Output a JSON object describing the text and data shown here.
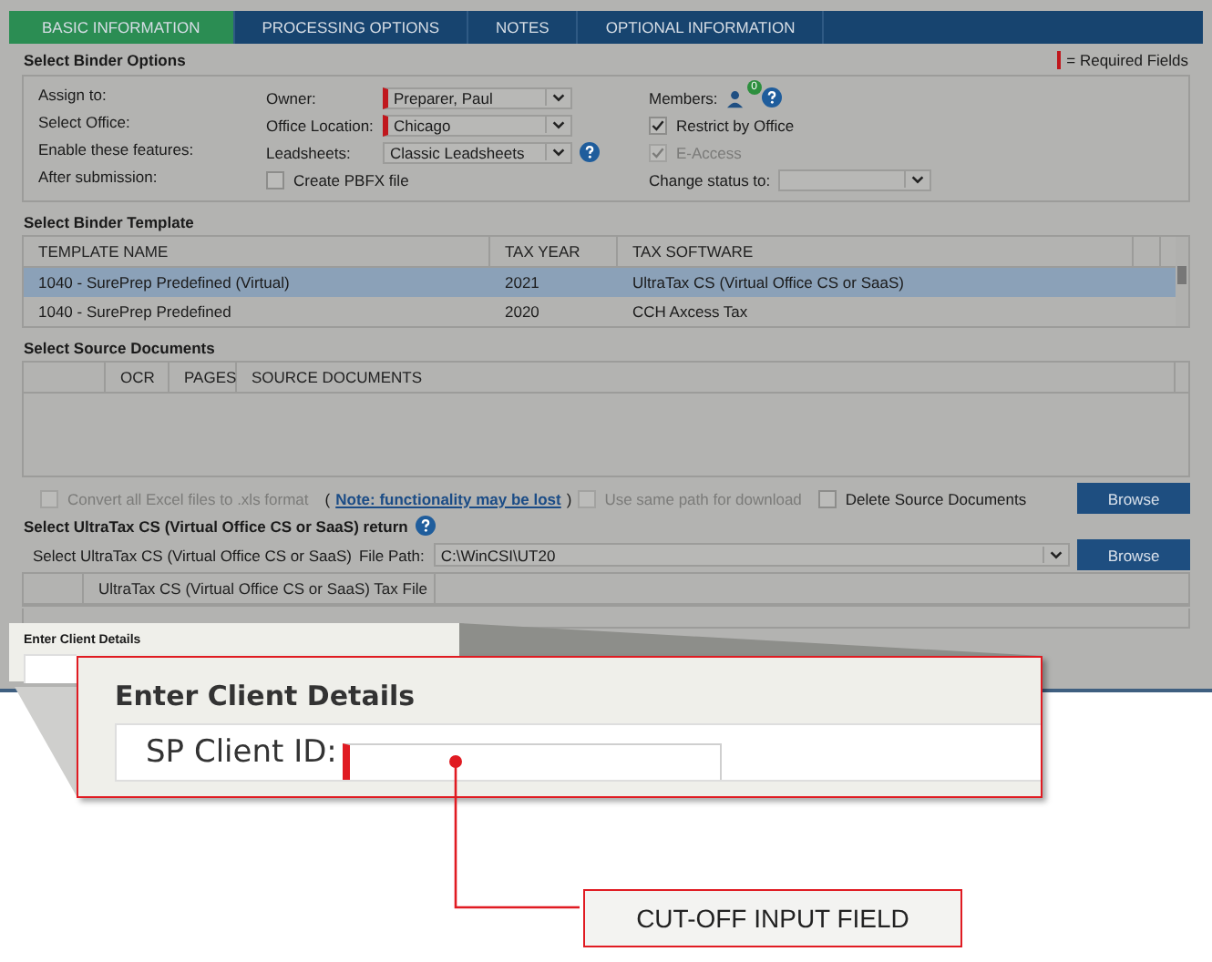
{
  "tabs": [
    {
      "label": "BASIC INFORMATION",
      "selected": true
    },
    {
      "label": "PROCESSING OPTIONS",
      "selected": false
    },
    {
      "label": "NOTES",
      "selected": false
    },
    {
      "label": "OPTIONAL INFORMATION",
      "selected": false
    }
  ],
  "binder_options": {
    "title": "Select Binder Options",
    "legend": "= Required Fields",
    "row_labels": [
      "Assign to:",
      "Select Office:",
      "Enable these features:",
      "After submission:"
    ],
    "owner": {
      "label": "Owner:",
      "value": "Preparer, Paul",
      "required": true
    },
    "office": {
      "label": "Office Location:",
      "value": "Chicago",
      "required": true
    },
    "leadsheets": {
      "label": "Leadsheets:",
      "value": "Classic Leadsheets",
      "required": false
    },
    "create_pbfx": {
      "label": "Create PBFX file",
      "checked": false,
      "disabled": false
    },
    "members": {
      "label": "Members:",
      "count": "0"
    },
    "restrict_by_office": {
      "label": "Restrict by Office",
      "checked": true,
      "disabled": false
    },
    "e_access": {
      "label": "E-Access",
      "checked": true,
      "disabled": true
    },
    "change_status": {
      "label": "Change status to:"
    }
  },
  "template": {
    "title": "Select Binder Template",
    "columns": [
      "TEMPLATE NAME",
      "TAX YEAR",
      "TAX SOFTWARE"
    ],
    "rows": [
      {
        "cells": [
          "1040 - SurePrep Predefined (Virtual)",
          "2021",
          "UltraTax CS (Virtual Office CS or SaaS)"
        ],
        "selected": true
      },
      {
        "cells": [
          "1040 - SurePrep Predefined",
          "2020",
          "CCH Axcess Tax"
        ],
        "selected": false
      }
    ]
  },
  "source_documents": {
    "title": "Select Source Documents",
    "columns": [
      "OCR",
      "PAGES",
      "SOURCE DOCUMENTS"
    ],
    "convert_excel": {
      "label": "Convert all Excel files to .xls format",
      "checked": false,
      "disabled": true
    },
    "note_open": "(",
    "note_link": "Note: functionality may be lost",
    "note_close": ")",
    "same_path": {
      "label": "Use same path for download",
      "checked": false,
      "disabled": true
    },
    "delete_source": {
      "label": "Delete Source Documents",
      "checked": false,
      "disabled": false
    },
    "browse": "Browse"
  },
  "ultratax": {
    "title": "Select UltraTax CS (Virtual Office CS or SaaS) return",
    "select_label": "Select UltraTax CS (Virtual Office CS or SaaS)",
    "path_label": "File Path:",
    "path_value": "C:\\WinCSI\\UT20",
    "browse": "Browse",
    "columns": [
      "UltraTax CS (Virtual Office CS or SaaS) Tax File"
    ]
  },
  "client_panel": {
    "title": "Enter Client Details"
  },
  "magnifier": {
    "title": "Enter Client Details",
    "field_label": "SP Client ID:",
    "required": true
  },
  "callout": "CUT-OFF INPUT FIELD"
}
